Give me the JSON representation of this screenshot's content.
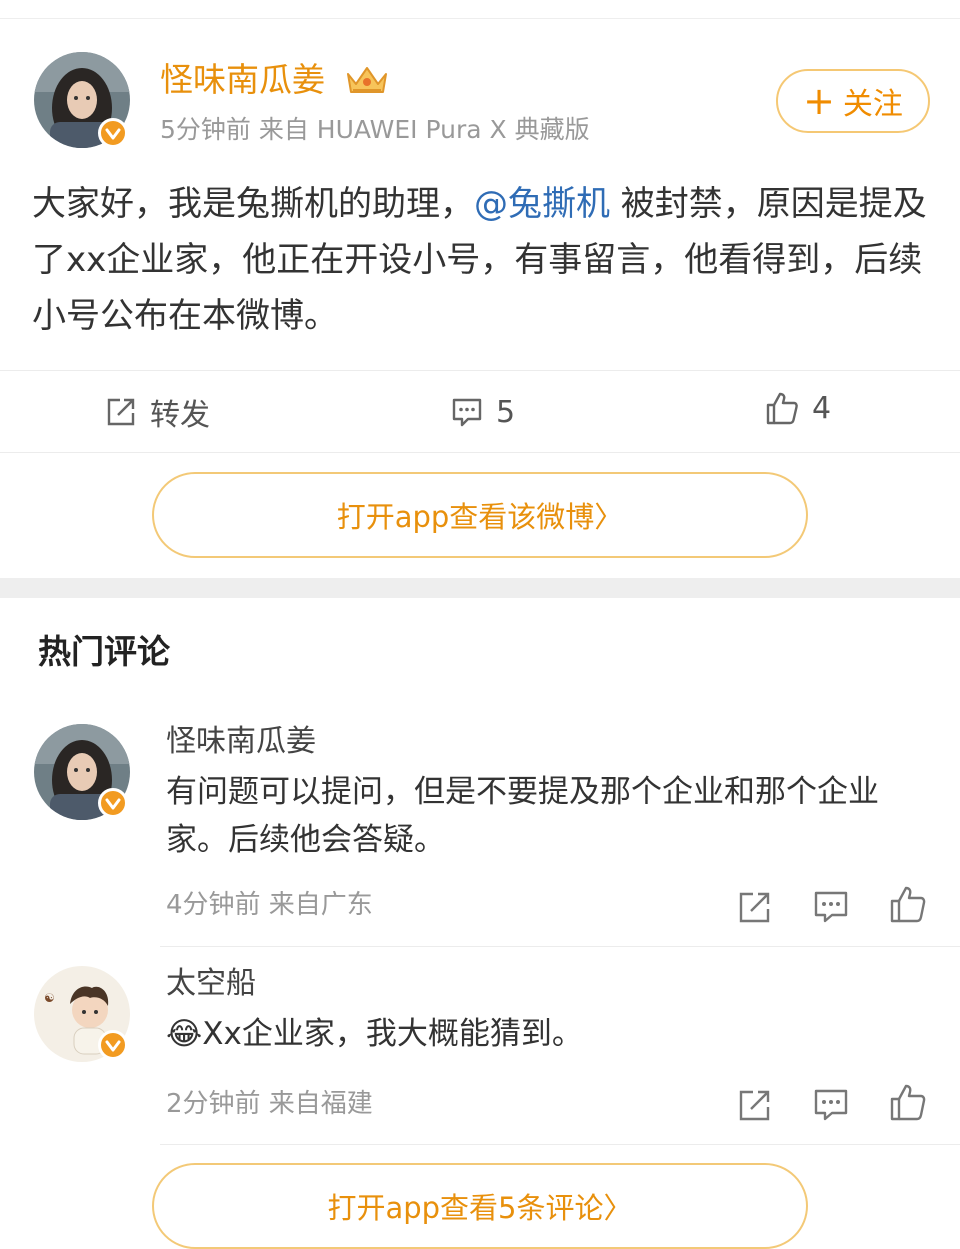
{
  "post": {
    "author": "怪味南瓜姜",
    "meta": "5分钟前  来自 HUAWEI Pura X 典藏版",
    "follow_label": "关注",
    "follow_plus": "+",
    "body_before": "大家好，我是兔撕机的助理，",
    "mention": "@兔撕机",
    "body_after": " 被封禁，原因是提及了xx企业家，他正在开设小号，有事留言，他看得到，后续小号公布在本微博。",
    "actions": {
      "repost": "转发",
      "comments": "5",
      "likes": "4"
    },
    "open_app": "打开app查看该微博",
    "chevron": "〉"
  },
  "comments_section": {
    "title": "热门评论",
    "comments": [
      {
        "user": "怪味南瓜姜",
        "text": "有问题可以提问，但是不要提及那个企业和那个企业家。后续他会答疑。",
        "meta": "4分钟前 来自广东"
      },
      {
        "user": "太空船",
        "emoji": "😂",
        "text": "Xx企业家，我大概能猜到。",
        "meta": "2分钟前 来自福建"
      }
    ],
    "open_app": "打开app查看5条评论",
    "chevron": "〉"
  },
  "colors": {
    "accent": "#e8900c",
    "mention": "#2f6cb5",
    "border": "#f3c977",
    "verified": "#f29b21"
  },
  "icons": [
    "crown-icon",
    "verified-icon",
    "repost-icon",
    "comment-icon",
    "like-icon",
    "share-icon",
    "reply-icon"
  ]
}
